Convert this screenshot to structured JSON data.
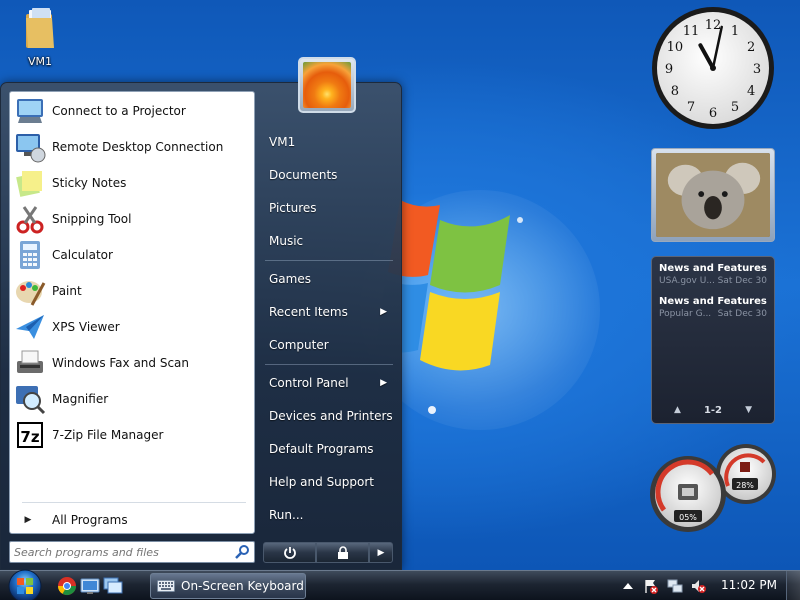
{
  "desktop": {
    "icons": [
      {
        "label": "VM1",
        "icon": "folder-icon"
      }
    ]
  },
  "start_menu": {
    "programs": [
      {
        "label": "Connect to a Projector",
        "icon": "projector-icon"
      },
      {
        "label": "Remote Desktop Connection",
        "icon": "remote-desktop-icon"
      },
      {
        "label": "Sticky Notes",
        "icon": "sticky-notes-icon"
      },
      {
        "label": "Snipping Tool",
        "icon": "snipping-tool-icon"
      },
      {
        "label": "Calculator",
        "icon": "calculator-icon"
      },
      {
        "label": "Paint",
        "icon": "paint-icon"
      },
      {
        "label": "XPS Viewer",
        "icon": "xps-viewer-icon"
      },
      {
        "label": "Windows Fax and Scan",
        "icon": "fax-scan-icon"
      },
      {
        "label": "Magnifier",
        "icon": "magnifier-icon"
      },
      {
        "label": "7-Zip File Manager",
        "icon": "seven-zip-icon"
      }
    ],
    "all_programs": "All Programs",
    "search_placeholder": "Search programs and files",
    "right_links": [
      {
        "label": "VM1",
        "arrow": false
      },
      {
        "label": "Documents",
        "arrow": false
      },
      {
        "label": "Pictures",
        "arrow": false
      },
      {
        "label": "Music",
        "arrow": false
      },
      {
        "label": "Games",
        "arrow": false
      },
      {
        "label": "Recent Items",
        "arrow": true
      },
      {
        "label": "Computer",
        "arrow": false
      },
      {
        "label": "Control Panel",
        "arrow": true
      },
      {
        "label": "Devices and Printers",
        "arrow": false
      },
      {
        "label": "Default Programs",
        "arrow": false
      },
      {
        "label": "Help and Support",
        "arrow": false
      },
      {
        "label": "Run...",
        "arrow": false
      }
    ]
  },
  "gadgets": {
    "clock": {
      "hour": 11,
      "minute": 2
    },
    "feed": {
      "items": [
        {
          "title": "News and Features f...",
          "source": "USA.gov U...",
          "date": "Sat Dec 30"
        },
        {
          "title": "News and Features f...",
          "source": "Popular G...",
          "date": "Sat Dec 30"
        }
      ],
      "page": "1-2"
    },
    "meter": {
      "cpu": "05%",
      "memory": "28%"
    }
  },
  "taskbar": {
    "quick_launch": [
      "chrome-icon",
      "desktop-icon",
      "window-switch-icon"
    ],
    "tasks": [
      {
        "label": "On-Screen Keyboard",
        "icon": "keyboard-icon"
      }
    ],
    "tray_icons": [
      "show-hidden-icons",
      "action-center-icon",
      "network-icon",
      "volume-muted-icon"
    ],
    "clock": "11:02 PM"
  },
  "colors": {
    "accent": "#1566c7",
    "taskbar": "#1d2532",
    "start_menu": "#2a3a50"
  }
}
